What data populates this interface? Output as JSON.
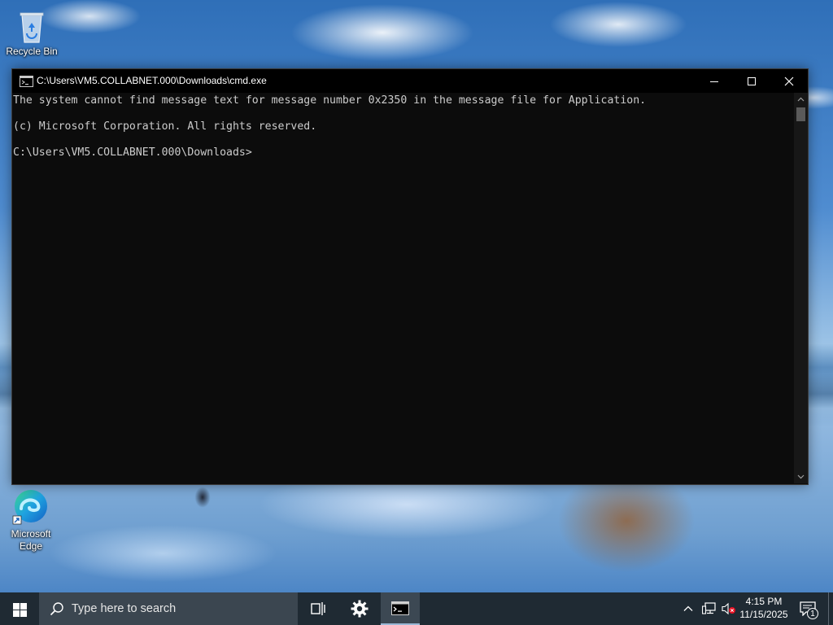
{
  "desktop": {
    "icons": [
      {
        "label": "Recycle Bin",
        "icon": "recycle-bin-icon"
      },
      {
        "label": "Microsoft Edge",
        "icon": "edge-icon"
      }
    ]
  },
  "cmd_window": {
    "title": "C:\\Users\\VM5.COLLABNET.000\\Downloads\\cmd.exe",
    "lines": [
      "The system cannot find message text for message number 0x2350 in the message file for Application.",
      "",
      "(c) Microsoft Corporation. All rights reserved.",
      "",
      "C:\\Users\\VM5.COLLABNET.000\\Downloads>"
    ],
    "background": "#0c0c0c",
    "foreground": "#cccccc"
  },
  "taskbar": {
    "search_placeholder": "Type here to search",
    "time": "4:15 PM",
    "date": "11/15/2025",
    "notification_count": "1",
    "pinned": [
      "task-view-icon",
      "settings-icon",
      "cmd-icon"
    ],
    "tray": [
      "chevron-up-icon",
      "network-icon",
      "volume-muted-icon"
    ]
  }
}
